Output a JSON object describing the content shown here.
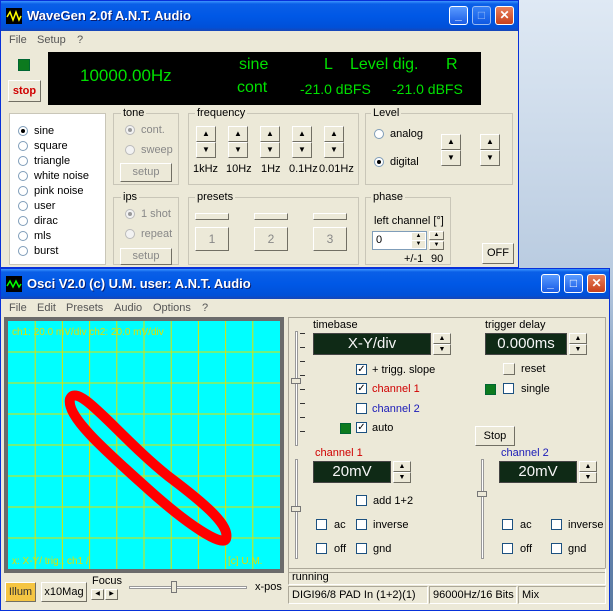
{
  "wavegen": {
    "title": "WaveGen 2.0f  A.N.T. Audio",
    "menu": [
      "File",
      "Setup",
      "?"
    ],
    "stop_label": "stop",
    "display": {
      "frequency": "10000.00Hz",
      "waveform": "sine",
      "mode": "cont",
      "l_label": "L",
      "level_label": "Level dig.",
      "r_label": "R",
      "level_left": "-21.0 dBFS",
      "level_right": "-21.0 dBFS"
    },
    "waveforms": [
      "sine",
      "square",
      "triangle",
      "white noise",
      "pink noise",
      "user",
      "dirac",
      "mls",
      "burst"
    ],
    "waveform_selected": "sine",
    "tone": {
      "title": "tone",
      "options": [
        "cont.",
        "sweep"
      ],
      "setup": "setup"
    },
    "ips": {
      "title": "ips",
      "options": [
        "1 shot",
        "repeat"
      ],
      "setup": "setup"
    },
    "frequency": {
      "title": "frequency",
      "steps": [
        "1kHz",
        "10Hz",
        "1Hz",
        "0.1Hz",
        "0.01Hz"
      ]
    },
    "presets": {
      "title": "presets",
      "buttons": [
        "1",
        "2",
        "3"
      ]
    },
    "level": {
      "title": "Level",
      "options": [
        "analog",
        "digital"
      ],
      "selected": "digital"
    },
    "phase": {
      "title": "phase",
      "label": "left channel [°]",
      "value": "0",
      "range_a": "+/-1",
      "range_b": "90"
    },
    "off_label": "OFF"
  },
  "osci": {
    "title": "Osci V2.0  (c) U.M.  user: A.N.T. Audio",
    "menu": [
      "File",
      "Edit",
      "Presets",
      "Audio",
      "Options",
      "?"
    ],
    "screen": {
      "header": "ch1: 20.0 mV/div  ch2: 20.0 mV/div",
      "footer": "x: X-Y/   trig.: ch1 /",
      "copyright": "[c] U.M."
    },
    "timebase": {
      "title": "timebase",
      "value": "X-Y/div"
    },
    "trigger_delay": {
      "title": "trigger delay",
      "value": "0.000ms"
    },
    "checks": {
      "trigg_slope": "+ trigg. slope",
      "channel1": "channel 1",
      "channel2": "channel 2",
      "auto": "auto",
      "reset": "reset",
      "single": "single",
      "add12": "add 1+2"
    },
    "stop_label": "Stop",
    "channel1": {
      "title": "channel 1",
      "value": "20mV",
      "ac": "ac",
      "inverse": "inverse",
      "off": "off",
      "gnd": "gnd"
    },
    "channel2": {
      "title": "channel 2",
      "value": "20mV",
      "ac": "ac",
      "inverse": "inverse",
      "off": "off",
      "gnd": "gnd"
    },
    "bottom": {
      "illum": "Illum",
      "x10mag": "x10Mag",
      "focus": "Focus",
      "xpos": "x-pos"
    },
    "status": {
      "state": "running",
      "device": "DIGI96/8 PAD In (1+2)(1)",
      "rate": "96000Hz/16 Bits",
      "mix": "Mix"
    },
    "colors": {
      "screen_bg": "#00ffff",
      "grid": "#e0e000",
      "trace": "#ff0000"
    }
  }
}
